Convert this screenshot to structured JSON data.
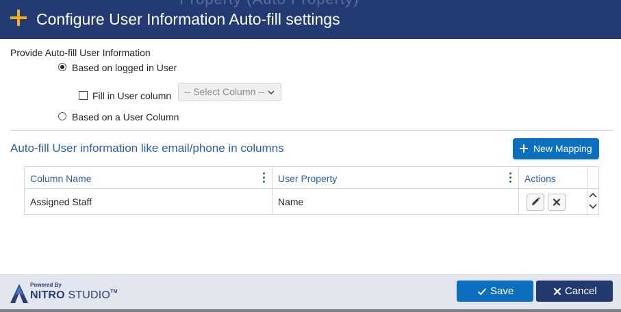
{
  "dialog": {
    "title": "Configure User Information Auto-fill settings",
    "background_title": "Property (Auto Property)"
  },
  "autofill": {
    "provide_label": "Provide Auto-fill User Information",
    "option_logged_in": {
      "label": "Based on logged in User",
      "checked": true
    },
    "fill_in_column": {
      "label": "Fill in User column",
      "checked": false
    },
    "select_column": {
      "value": "-- Select Column --"
    },
    "option_user_column": {
      "label": "Based on a User Column",
      "checked": false
    }
  },
  "mapping": {
    "section_title": "Auto-fill User information like email/phone in columns",
    "new_button_label": "New Mapping",
    "columns": [
      "Column Name",
      "User Property",
      "Actions"
    ],
    "rows": [
      {
        "column_name": "Assigned Staff",
        "user_property": "Name"
      }
    ]
  },
  "footer": {
    "logo_powered_by": "Powered By",
    "logo_brand": "NITRO",
    "logo_product": "STUDIO",
    "logo_tm": "TM",
    "save_label": "Save",
    "cancel_label": "Cancel"
  },
  "colors": {
    "header_bg": "#233a72",
    "accent_plus": "#f2b01e",
    "primary_button": "#0d6fbf",
    "cancel_button": "#223a6e",
    "link_text": "#2a5fa8",
    "footer_bg": "#e2e6ee"
  },
  "icons": [
    "plus-icon",
    "chevron-down-icon",
    "kebab-menu-icon",
    "pencil-icon",
    "close-icon",
    "scroll-up-icon",
    "scroll-down-icon",
    "check-icon",
    "nitro-logo-icon"
  ]
}
